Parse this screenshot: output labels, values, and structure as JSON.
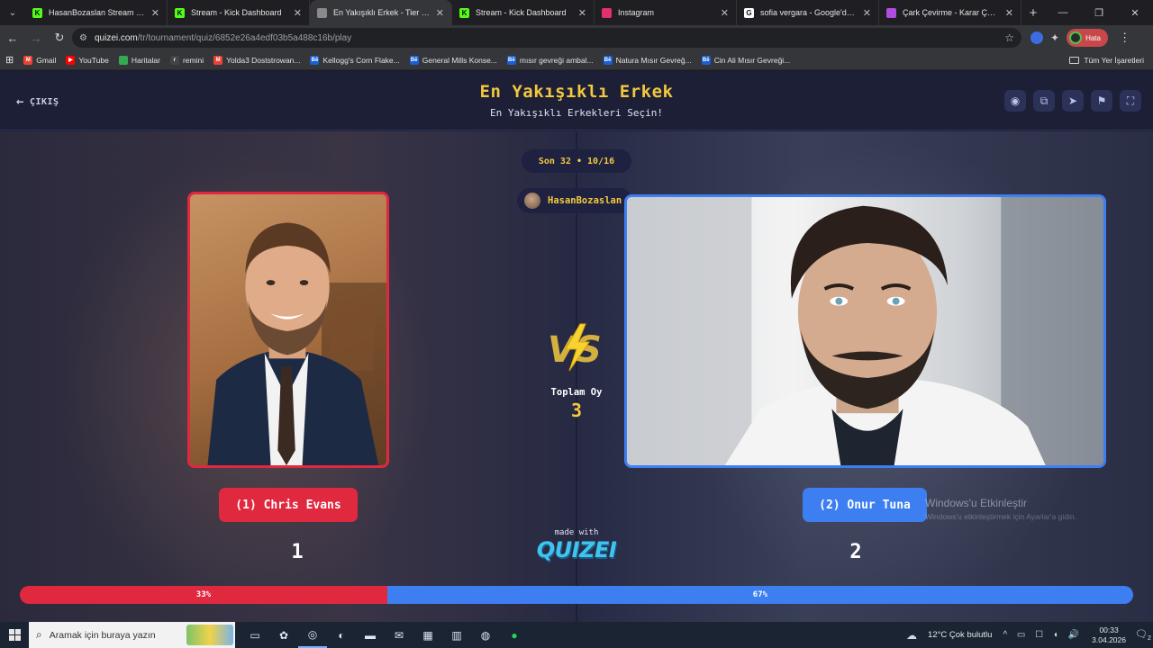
{
  "browser": {
    "tabs": [
      {
        "title": "HasanBozaslan Stream - Watch",
        "favicon_color": "#53fc18",
        "favicon_glyph": "K",
        "active": false
      },
      {
        "title": "Stream - Kick Dashboard",
        "favicon_color": "#53fc18",
        "favicon_glyph": "K",
        "active": false
      },
      {
        "title": "En Yakışıklı Erkek - Tier List, Kör",
        "favicon_color": "#8a8a8a",
        "favicon_glyph": "",
        "active": true
      },
      {
        "title": "Stream - Kick Dashboard",
        "favicon_color": "#53fc18",
        "favicon_glyph": "K",
        "active": false
      },
      {
        "title": "Instagram",
        "favicon_color": "#e1306c",
        "favicon_glyph": "",
        "active": false
      },
      {
        "title": "sofia vergara - Google'da Ara",
        "favicon_color": "#ffffff",
        "favicon_glyph": "G",
        "active": false
      },
      {
        "title": "Çark Çevirme - Karar Çarkı!",
        "favicon_color": "#b04ce0",
        "favicon_glyph": "",
        "active": false
      }
    ],
    "url_host": "quizei.com",
    "url_path": "/tr/tournament/quiz/6852e26a4edf03b5a488c16b/play",
    "profile_label": "Hata",
    "bookmarks": [
      {
        "label": "Gmail",
        "color": "#ea4335",
        "glyph": "M"
      },
      {
        "label": "YouTube",
        "color": "#ff0000",
        "glyph": "▶"
      },
      {
        "label": "Haritalar",
        "color": "#34a853",
        "glyph": ""
      },
      {
        "label": "remini",
        "color": "#444444",
        "glyph": "r"
      },
      {
        "label": "Yolda3 Doststrowan...",
        "color": "#ea4335",
        "glyph": "M"
      },
      {
        "label": "Kellogg's Corn Flake...",
        "color": "#1a5fd6",
        "glyph": "Bē"
      },
      {
        "label": "General Mills Konse...",
        "color": "#1a5fd6",
        "glyph": "Bē"
      },
      {
        "label": "mısır gevreği ambal...",
        "color": "#1a5fd6",
        "glyph": "Bē"
      },
      {
        "label": "Natura Mısır Gevreğ...",
        "color": "#1a5fd6",
        "glyph": "Bē"
      },
      {
        "label": "Cin Ali Mısır Gevreği...",
        "color": "#1a5fd6",
        "glyph": "Bē"
      }
    ],
    "all_bookmarks_label": "Tüm Yer İşaretleri"
  },
  "quiz": {
    "exit_label": "ÇIKIŞ",
    "title": "En Yakışıklı Erkek",
    "subtitle": "En Yakışıklı Erkekleri Seçin!",
    "round": "Son 32 • 10/16",
    "streamer": "HasanBozaslan",
    "total_votes_label": "Toplam Oy",
    "total_votes": 3,
    "made_with_label": "made with",
    "brand": "QUIZEI",
    "left": {
      "label": "(1) Chris Evans",
      "votes": "1",
      "percent": 33,
      "percent_label": "33%",
      "color": "#e0283f"
    },
    "right": {
      "label": "(2) Onur Tuna",
      "votes": "2",
      "percent": 67,
      "percent_label": "67%",
      "color": "#3d7ef1"
    },
    "header_icons": [
      "eye-icon",
      "share-icon",
      "send-icon",
      "flag-icon",
      "fullscreen-icon"
    ]
  },
  "os": {
    "activation_title": "Windows'u Etkinleştir",
    "activation_sub": "Windows'u etkinleştirmek için Ayarlar'a gidin.",
    "search_placeholder": "Aramak için buraya yazın",
    "weather": "12°C  Çok bulutlu",
    "time": "00:33",
    "date": "3.04.2026",
    "notification_count": "2"
  }
}
